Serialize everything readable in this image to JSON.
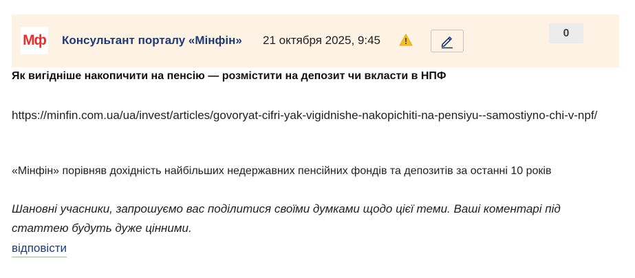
{
  "header": {
    "logo_text": "Мф",
    "author": "Консультант порталу «Мінфін»",
    "date": "21 октября 2025, 9:45",
    "counter": "0",
    "icons": {
      "warning": "warning-icon",
      "edit": "pencil-icon"
    },
    "colors": {
      "header_bg": "#fdf2e3",
      "logo_red": "#e53030",
      "author_blue": "#1e3b73",
      "warning_yellow": "#f2c12e"
    }
  },
  "post": {
    "title": "Як вигідніше накопичити на пенсію — розмістити на депозит чи вкласти в НПФ",
    "link": "https://minfin.com.ua/ua/invest/articles/govoryat-cifri-yak-vigidnishe-nakopichiti-na-pensiyu--samostiyno-chi-v-npf/",
    "summary": "«Мінфін» порівняв дохідність найбільших недержавних пенсійних фондів та депозитів за останні 10 років",
    "invite": "Шановні учасники, запрошуємо вас поділитися своїми думками щодо цієї теми. Ваші коментарі під статтею будуть дуже цінними.",
    "reply_label": "відповісти"
  }
}
